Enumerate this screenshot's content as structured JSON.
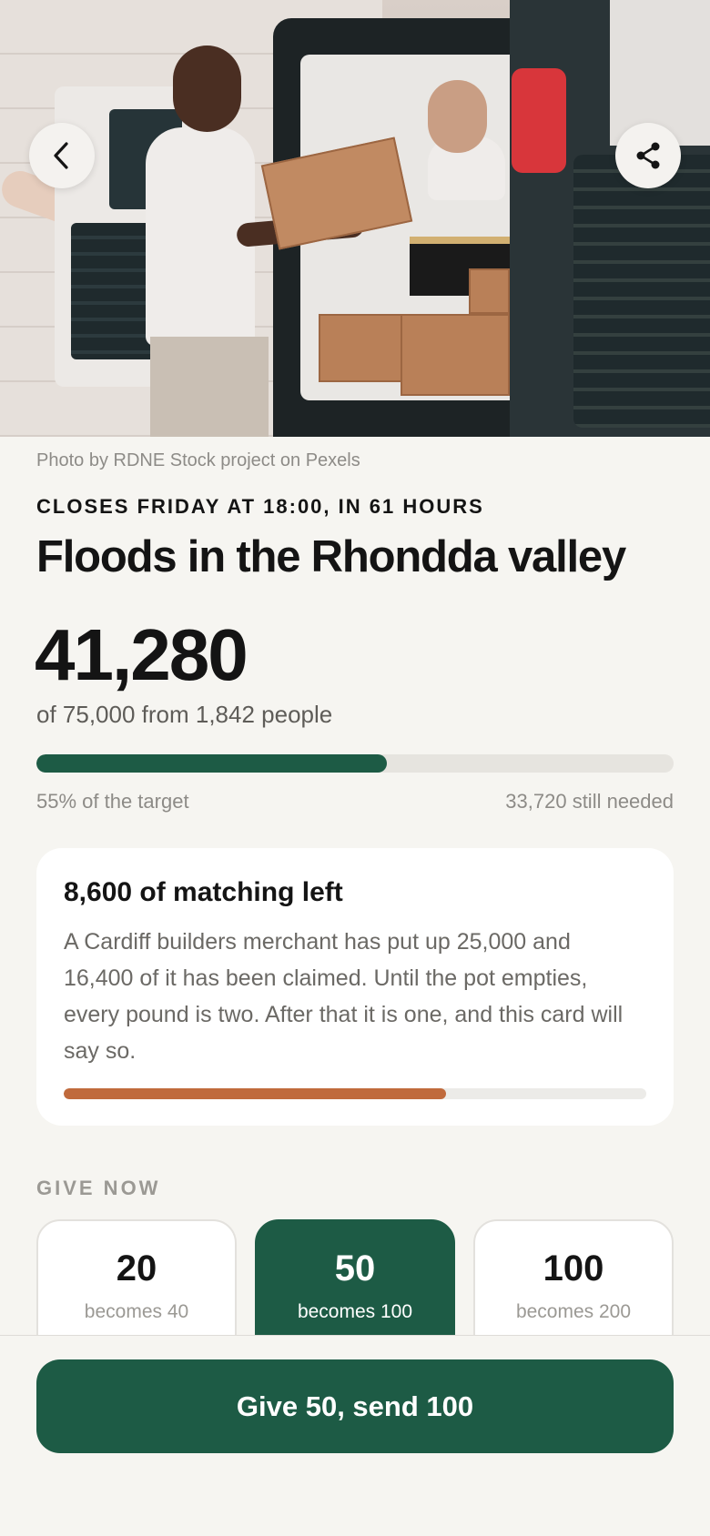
{
  "hero": {
    "alt": "Volunteers loading boxes marked FOOD AID and Medicine into a van",
    "credit": "Photo by RDNE Stock project on Pexels"
  },
  "appeal": {
    "closes": "CLOSES FRIDAY AT 18:00, IN 61 HOURS",
    "title": "Floods in the Rhondda valley",
    "raised": "41,280",
    "of_target": "of 75,000 from 1,842 people",
    "progress_fraction": 0.55,
    "percent_label": "55% of the target",
    "needed_label": "33,720 still needed"
  },
  "matching": {
    "title": "8,600 of matching left",
    "body": "A Cardiff builders merchant has put up 25,000 and 16,400 of it has been claimed. Until the pot empties, every pound is two. After that it is one, and this card will say so.",
    "progress_fraction": 0.656
  },
  "give": {
    "label": "GIVE NOW",
    "options": [
      {
        "amount": "20",
        "becomes": "becomes 40",
        "selected": false
      },
      {
        "amount": "50",
        "becomes": "becomes 100",
        "selected": true
      },
      {
        "amount": "100",
        "becomes": "becomes 200",
        "selected": false
      }
    ],
    "cta": "Give 50, send 100"
  },
  "icons": {
    "back": "chevron-left-icon",
    "share": "share-icon"
  },
  "colors": {
    "accent": "#1d5b45",
    "matching": "#c06a3c",
    "background": "#f6f5f1"
  }
}
